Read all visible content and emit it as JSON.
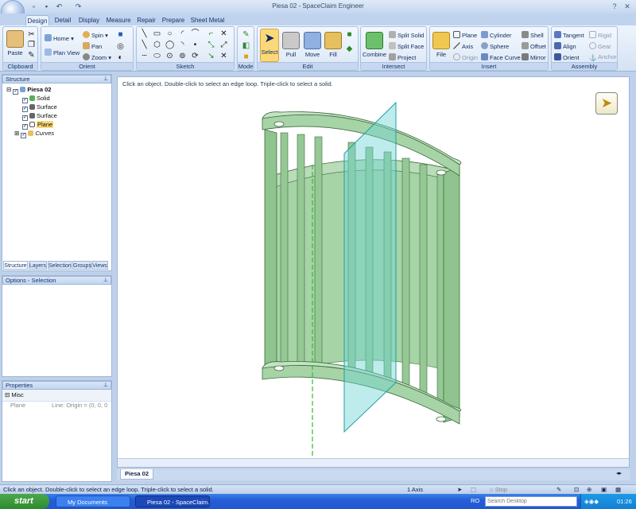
{
  "window": {
    "title": "Piesa 02 - SpaceClaim Engineer"
  },
  "tabs": [
    "Design",
    "Detail",
    "Display",
    "Measure",
    "Repair",
    "Prepare",
    "Sheet Metal"
  ],
  "ribbon": {
    "clipboard": {
      "label": "Clipboard",
      "paste": "Paste"
    },
    "orient": {
      "label": "Orient",
      "home": "Home",
      "plan_view": "Plan View",
      "spin": "Spin",
      "pan": "Pan",
      "zoom": "Zoom"
    },
    "sketch": {
      "label": "Sketch"
    },
    "mode": {
      "label": "Mode"
    },
    "edit": {
      "label": "Edit",
      "select": "Select",
      "pull": "Pull",
      "move": "Move",
      "fill": "Fill"
    },
    "intersect": {
      "label": "Intersect",
      "combine": "Combine",
      "split_solid": "Split Solid",
      "split_face": "Split Face",
      "project": "Project"
    },
    "insert": {
      "label": "Insert",
      "file": "File",
      "plane": "Plane",
      "axis": "Axis",
      "origin": "Origin",
      "cylinder": "Cylinder",
      "sphere": "Sphere",
      "face_curve": "Face Curve",
      "shell": "Shell",
      "offset": "Offset",
      "mirror": "Mirror"
    },
    "assembly": {
      "label": "Assembly",
      "tangent": "Tangent",
      "align": "Align",
      "orient": "Orient",
      "rigid": "Rigid",
      "gear": "Gear",
      "anchor": "Anchor"
    }
  },
  "structure": {
    "header": "Structure",
    "root": "Piesa 02",
    "items": [
      "Solid",
      "Surface",
      "Surface",
      "Plane",
      "Curves"
    ],
    "tabs": [
      "Structure",
      "Layers",
      "Selection",
      "Groups",
      "Views"
    ]
  },
  "options": {
    "header": "Options - Selection"
  },
  "properties": {
    "header": "Properties",
    "group": "Misc",
    "name": "Plane",
    "value": "Line: Origin = (0, 0, 0"
  },
  "canvas": {
    "hint": "Click an object. Double-click to select an edge loop. Triple-click to select a solid.",
    "doc_tab": "Piesa 02"
  },
  "status": {
    "text": "Click an object. Double-click to select an edge loop. Triple-click to select a solid.",
    "selection": "1 Axis"
  },
  "taskbar": {
    "start": "start",
    "items": [
      "My Documents",
      "Piesa 02 - SpaceClaim..."
    ],
    "lang": "RO",
    "search_placeholder": "Search Desktop",
    "clock": "01:26"
  },
  "colors": {
    "accent": "#fbd97a",
    "part_fill": "#a6d4a6",
    "part_edge": "#3e6b3e",
    "plane": "#6fd4d4",
    "axis": "#2fbf2f"
  }
}
